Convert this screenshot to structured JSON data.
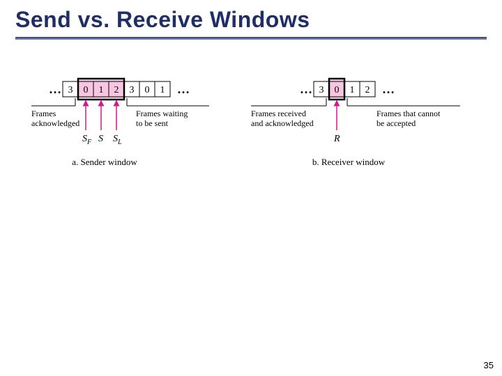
{
  "title": "Send vs. Receive Windows",
  "page_number": "35",
  "sender": {
    "cells": [
      "3",
      "0",
      "1",
      "2",
      "3",
      "0",
      "1"
    ],
    "window_start_index": 1,
    "window_end_index": 3,
    "label_left_line1": "Frames",
    "label_left_line2": "acknowledged",
    "label_right_line1": "Frames waiting",
    "label_right_line2": "to be sent",
    "pointer_sf": "S",
    "pointer_sf_sub": "F",
    "pointer_s": "S",
    "pointer_sl": "S",
    "pointer_sl_sub": "L",
    "caption": "a. Sender window"
  },
  "receiver": {
    "cells": [
      "3",
      "0",
      "1",
      "2"
    ],
    "window_index": 1,
    "label_left_line1": "Frames received",
    "label_left_line2": "and acknowledged",
    "label_right_line1": "Frames that cannot",
    "label_right_line2": "be accepted",
    "pointer_r": "R",
    "caption": "b. Receiver window"
  },
  "chart_data": {
    "type": "table",
    "title": "Sliding window diagram: sender vs receiver",
    "sender_window": {
      "sequence_shown": [
        3,
        0,
        1,
        2,
        3,
        0,
        1
      ],
      "SF_points_to": 0,
      "S_points_to": 1,
      "SL_points_to": 2,
      "highlighted_window_values": [
        0,
        1,
        2
      ],
      "before_window_label": "Frames acknowledged",
      "after_window_label": "Frames waiting to be sent"
    },
    "receiver_window": {
      "sequence_shown": [
        3,
        0,
        1,
        2
      ],
      "R_points_to": 0,
      "highlighted_window_values": [
        0
      ],
      "before_window_label": "Frames received and acknowledged",
      "after_window_label": "Frames that cannot be accepted"
    }
  }
}
